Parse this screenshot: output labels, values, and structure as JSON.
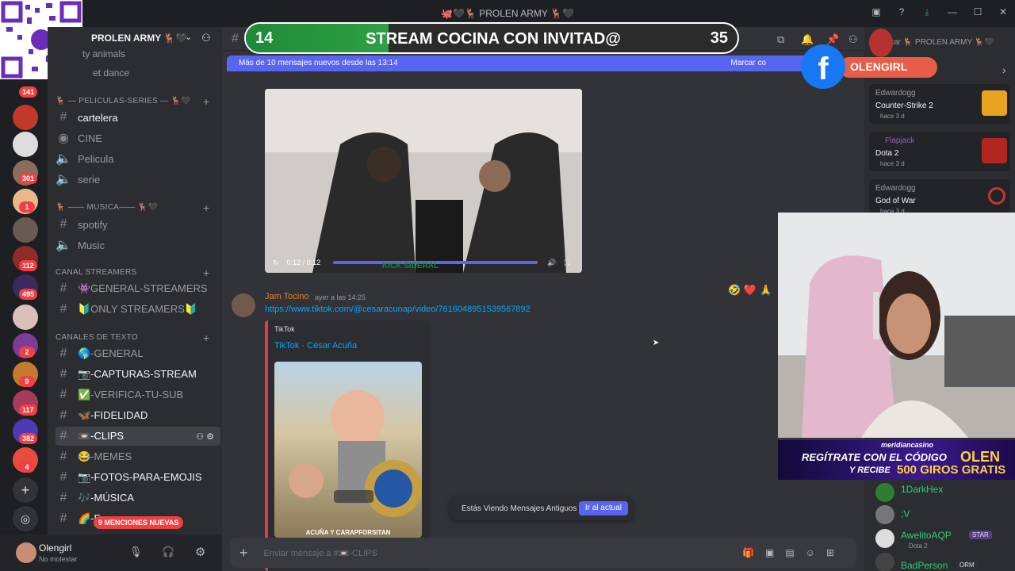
{
  "window": {
    "title": "🐙🖤🦌 PROLEN ARMY 🦌🖤"
  },
  "server": {
    "name": "PROLEN ARMY 🦌🖤",
    "top_items": [
      "ty animals",
      "et dance"
    ]
  },
  "badges": [
    "141",
    "301",
    "1",
    "112",
    "495",
    "2",
    "9",
    "117",
    "382",
    "4"
  ],
  "categories": {
    "peliculas": "🦌 — PELICULAS-SERIES — 🦌🖤",
    "musica": "🦌 —— MUSICA—— 🦌🖤",
    "streamers": "CANAL STREAMERS",
    "texto": "CANALES DE TEXTO"
  },
  "channels": {
    "cartelera": "cartelera",
    "cine": "CINE",
    "pelicula": "Pelicula",
    "serie": "serie",
    "spotify": "spotify",
    "music": "Music",
    "general_streamers": "👾GENERAL-STREAMERS",
    "only_streamers": "🔰ONLY STREAMERS🔰",
    "general": "🌎-GENERAL",
    "capturas": "📷-CAPTURAS-STREAM",
    "verifica": "✅-VERIFICA-TU-SUB",
    "fidelidad": "🦋-FIDELIDAD",
    "clips": "📼-CLIPS",
    "memes": "😂-MEMES",
    "fotos": "📷-FOTOS-PARA-EMOJIS",
    "musica": "🎶-MÚSICA",
    "last": "🌈-F"
  },
  "mentions_pill": "9 MENCIONES NUEVAS",
  "user": {
    "name": "Olengirl",
    "status": "No molestar"
  },
  "overlay": {
    "left_num": "14",
    "title": "STREAM COCINA CON INVITAD@",
    "right_num": "35"
  },
  "new_messages": {
    "text": "Más de 10 mensajes nuevos desde las 13:14",
    "mark": "Marcar co"
  },
  "header_right": "car 🦌 PROLEN ARMY 🦌🖤",
  "video": {
    "time": "0:12 / 0:12",
    "watermark": "KICK SIDERAL",
    "progress": 1.0
  },
  "message": {
    "author": "Jam Tocino",
    "timestamp": "ayer a las 14:25",
    "link": "https://www.tiktok.com/@cesaracunap/video/7616048951539567892",
    "embed_provider": "TikTok",
    "embed_title": "TikTok · César Acuña",
    "thumb_caption": "ACUÑA Y CARAPFORSITAN"
  },
  "old_messages": {
    "text": "Estás Viendo Mensajes Antiguos",
    "button": "Ir al actual"
  },
  "composer": {
    "placeholder": "Enviar mensaje a #📼-CLIPS"
  },
  "facebook": {
    "name": "OLENGIRL"
  },
  "activities": [
    {
      "user": "Edwardogg",
      "game": "Counter-Strike 2",
      "time": "hace 3 d"
    },
    {
      "user": "Flapjack",
      "game": "Dota 2",
      "time": "hace 3 d"
    },
    {
      "user": "Edwardogg",
      "game": "God of War",
      "time": "hace 3 d"
    }
  ],
  "casino": {
    "brand": "meridiancasino",
    "line1": "REGÍTRATE CON EL CÓDIGO",
    "code": "OLEN",
    "line2": "Y RECIBE",
    "promo": "500 GIROS GRATIS"
  },
  "chat": [
    {
      "name": "1DarkHex",
      "sub": "",
      "tag": ""
    },
    {
      "name": ";V",
      "sub": "",
      "tag": ""
    },
    {
      "name": "AwelitoAQP",
      "sub": "Dota 2",
      "tag": "STAR"
    },
    {
      "name": "BadPerson",
      "sub": "",
      "tag": "ORM"
    }
  ],
  "colors": {
    "accent": "#5865f2",
    "link": "#00a8fc",
    "author": "#e67e22",
    "badge": "#f23f43"
  }
}
